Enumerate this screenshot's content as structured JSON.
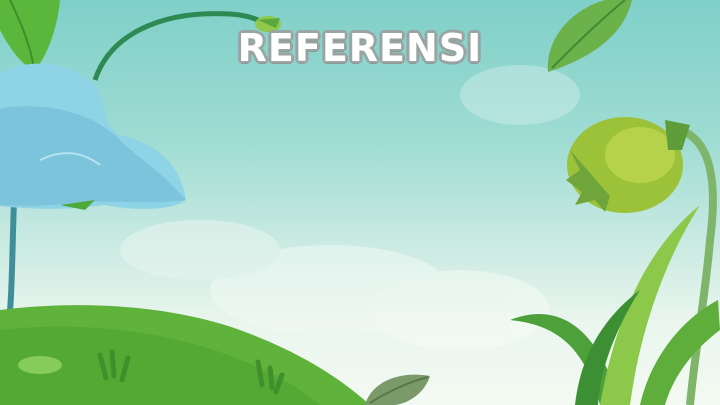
{
  "slide": {
    "title": "REFERENSI"
  },
  "colors": {
    "sky_top": "#7fd0c9",
    "sky_bottom": "#f3faf2",
    "grass": "#5fb23a",
    "leaf_dark": "#2f8f3a",
    "flower_blue": "#8fd3e6",
    "poppy_pod": "#9cc23a"
  }
}
